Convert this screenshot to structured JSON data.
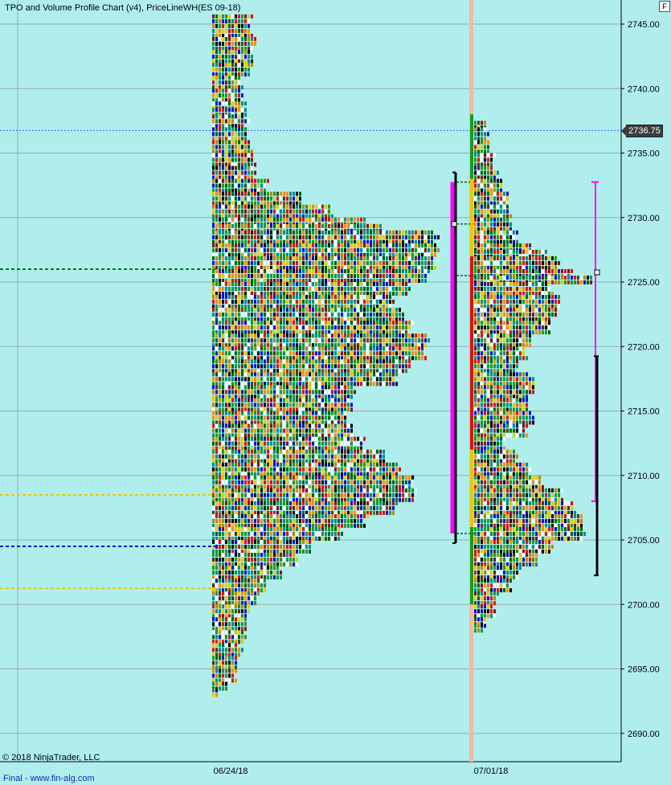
{
  "window": {
    "title": "TPO and Volume Profile Chart (v4), PriceLineWH(ES 09-18)",
    "f_button": "F",
    "copyright": "© 2018 NinjaTrader, LLC",
    "footer": "Final - www.fin-alg.com"
  },
  "chart_data": {
    "type": "heatmap",
    "title": "TPO and Volume Profile Chart (v4), PriceLineWH(ES 09-18)",
    "y_ticks": [
      "2745.00",
      "2740.00",
      "2735.00",
      "2730.00",
      "2725.00",
      "2720.00",
      "2715.00",
      "2710.00",
      "2705.00",
      "2700.00",
      "2695.00",
      "2690.00"
    ],
    "y_tick_values": [
      2745,
      2740,
      2735,
      2730,
      2725,
      2720,
      2715,
      2710,
      2705,
      2700,
      2695,
      2690
    ],
    "ylim": [
      2688.5,
      2746.5
    ],
    "x_ticks": [
      "06/24/18",
      "07/01/18"
    ],
    "current_price": 2736.75,
    "current_price_label": "2736.75",
    "grid": true,
    "colors": {
      "background": "#b0eeee",
      "tpo_palette": [
        "#006400",
        "#1a9a1a",
        "#e01010",
        "#1010d0",
        "#e8c800",
        "#008c8c",
        "#ffffff",
        "#000000",
        "#b8860b",
        "#ff8c00",
        "#2e8b57",
        "#7b1818"
      ],
      "magenta": "#ff00ff",
      "poc_week1": "#008000",
      "vah_week1": "#e8c800",
      "val_week1": "#0000cd",
      "current_price_line": "#3060ff",
      "divider": "#f5b8a0"
    },
    "profiles": [
      {
        "label": "06/24/18",
        "levels": [
          {
            "price": 2745.75,
            "width": 48
          },
          {
            "price": 2745,
            "width": 48
          },
          {
            "price": 2744,
            "width": 52
          },
          {
            "price": 2743,
            "width": 52
          },
          {
            "price": 2742,
            "width": 48
          },
          {
            "price": 2741,
            "width": 36
          },
          {
            "price": 2740,
            "width": 36
          },
          {
            "price": 2739,
            "width": 40
          },
          {
            "price": 2738.5,
            "width": 45
          },
          {
            "price": 2738,
            "width": 44
          },
          {
            "price": 2737,
            "width": 44
          },
          {
            "price": 2736,
            "width": 48
          },
          {
            "price": 2735,
            "width": 52
          },
          {
            "price": 2734,
            "width": 52
          },
          {
            "price": 2733,
            "width": 68
          },
          {
            "price": 2732,
            "width": 108
          },
          {
            "price": 2731,
            "width": 148
          },
          {
            "price": 2730,
            "width": 188
          },
          {
            "price": 2729.5,
            "width": 208
          },
          {
            "price": 2729,
            "width": 280
          },
          {
            "price": 2728,
            "width": 280
          },
          {
            "price": 2727,
            "width": 276
          },
          {
            "price": 2726,
            "width": 268
          },
          {
            "price": 2725,
            "width": 244
          },
          {
            "price": 2724,
            "width": 224
          },
          {
            "price": 2723,
            "width": 236
          },
          {
            "price": 2722,
            "width": 248
          },
          {
            "price": 2721,
            "width": 268
          },
          {
            "price": 2720,
            "width": 264
          },
          {
            "price": 2719,
            "width": 248
          },
          {
            "price": 2718,
            "width": 228
          },
          {
            "price": 2717,
            "width": 176
          },
          {
            "price": 2716,
            "width": 172
          },
          {
            "price": 2715,
            "width": 168
          },
          {
            "price": 2714,
            "width": 172
          },
          {
            "price": 2713,
            "width": 188
          },
          {
            "price": 2712,
            "width": 212
          },
          {
            "price": 2711,
            "width": 232
          },
          {
            "price": 2710,
            "width": 248
          },
          {
            "price": 2709,
            "width": 252
          },
          {
            "price": 2708,
            "width": 228
          },
          {
            "price": 2707,
            "width": 192
          },
          {
            "price": 2706,
            "width": 160
          },
          {
            "price": 2705,
            "width": 124
          },
          {
            "price": 2704,
            "width": 104
          },
          {
            "price": 2703,
            "width": 84
          },
          {
            "price": 2702,
            "width": 68
          },
          {
            "price": 2701,
            "width": 56
          },
          {
            "price": 2700,
            "width": 44
          },
          {
            "price": 2699,
            "width": 40
          },
          {
            "price": 2698,
            "width": 40
          },
          {
            "price": 2697,
            "width": 36
          },
          {
            "price": 2696,
            "width": 32
          },
          {
            "price": 2695,
            "width": 28
          },
          {
            "price": 2694,
            "width": 20
          },
          {
            "price": 2693.5,
            "width": 8
          }
        ],
        "poc": 2726,
        "value_area_high": 2708.5,
        "value_area_low": 2701.25,
        "poc_label_level": 2704.5
      },
      {
        "label": "07/01/18",
        "levels": [
          {
            "price": 2737.5,
            "width": 12
          },
          {
            "price": 2737,
            "width": 16
          },
          {
            "price": 2736,
            "width": 20
          },
          {
            "price": 2735,
            "width": 24
          },
          {
            "price": 2734,
            "width": 28
          },
          {
            "price": 2733,
            "width": 36
          },
          {
            "price": 2732,
            "width": 40
          },
          {
            "price": 2731,
            "width": 44
          },
          {
            "price": 2730,
            "width": 44
          },
          {
            "price": 2729,
            "width": 52
          },
          {
            "price": 2728,
            "width": 72
          },
          {
            "price": 2727.5,
            "width": 88
          },
          {
            "price": 2727,
            "width": 104
          },
          {
            "price": 2726,
            "width": 124
          },
          {
            "price": 2725.5,
            "width": 148
          },
          {
            "price": 2725,
            "width": 96
          },
          {
            "price": 2724,
            "width": 104
          },
          {
            "price": 2723,
            "width": 100
          },
          {
            "price": 2722,
            "width": 96
          },
          {
            "price": 2721,
            "width": 72
          },
          {
            "price": 2720,
            "width": 64
          },
          {
            "price": 2719,
            "width": 56
          },
          {
            "price": 2718,
            "width": 72
          },
          {
            "price": 2717,
            "width": 72
          },
          {
            "price": 2716,
            "width": 68
          },
          {
            "price": 2715,
            "width": 72
          },
          {
            "price": 2714,
            "width": 64
          },
          {
            "price": 2713,
            "width": 40
          },
          {
            "price": 2712,
            "width": 52
          },
          {
            "price": 2711,
            "width": 68
          },
          {
            "price": 2710,
            "width": 84
          },
          {
            "price": 2709,
            "width": 108
          },
          {
            "price": 2708,
            "width": 124
          },
          {
            "price": 2707,
            "width": 132
          },
          {
            "price": 2706,
            "width": 136
          },
          {
            "price": 2705,
            "width": 96
          },
          {
            "price": 2704,
            "width": 76
          },
          {
            "price": 2703,
            "width": 56
          },
          {
            "price": 2702,
            "width": 44
          },
          {
            "price": 2701,
            "width": 32
          },
          {
            "price": 2700,
            "width": 24
          },
          {
            "price": 2699,
            "width": 16
          },
          {
            "price": 2698.5,
            "width": 12
          }
        ],
        "range_high": 2733.5,
        "range_low": 2704.75,
        "value_area_high": 2732.75,
        "value_area_low": 2705.5,
        "poc": 2729.5
      }
    ],
    "right_markers": {
      "magenta_high": 2732.75,
      "magenta_low": 2708.0,
      "black_high": 2719.25,
      "black_low": 2702.25,
      "box_level": 2725.75
    }
  }
}
